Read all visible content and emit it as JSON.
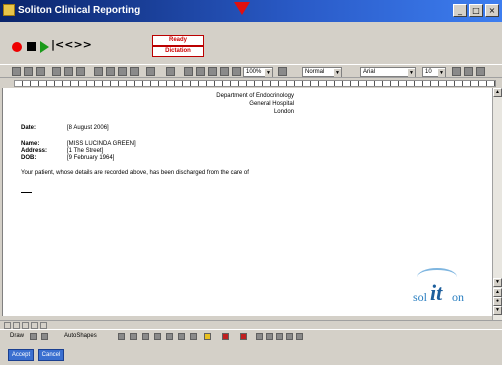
{
  "window": {
    "title": "Soliton Clinical Reporting",
    "controls": [
      "_",
      "□",
      "×"
    ]
  },
  "dictation": {
    "nav_label": "|<<>>",
    "status_ready": "Ready",
    "status_mode": "Dictation"
  },
  "format_toolbar": {
    "zoom": "100%",
    "style": "Normal",
    "font": "Arial",
    "size": "10"
  },
  "document": {
    "address_line_1": "Department of Endocrinology",
    "address_line_2": "General Hospital",
    "address_line_3": "London",
    "date_label": "Date:",
    "date_value": "[8 August 2006]",
    "name_label": "Name:",
    "name_value": "[MISS LUCINDA GREEN]",
    "address_label": "Address:",
    "address_value": "[1 The Street]",
    "dob_label": "DOB:",
    "dob_value": "[9 February 1964]",
    "body_text": "Your patient, whose details are recorded above, has been discharged from the care of"
  },
  "logo": {
    "part1": "sol",
    "part2": "it",
    "part3": "on"
  },
  "drawing_toolbar": {
    "draw_label": "Draw",
    "autoshapes_label": "AutoShapes"
  },
  "footer": {
    "ok_label": "Accept",
    "cancel_label": "Cancel"
  }
}
